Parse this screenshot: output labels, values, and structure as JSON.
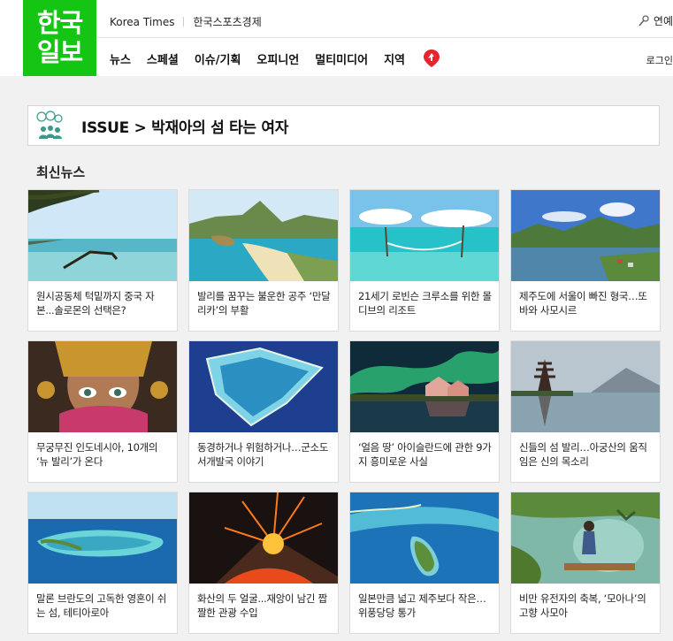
{
  "header": {
    "logo_line1": "한국",
    "logo_line2": "일보",
    "top_links": [
      "Korea Times",
      "한국스포츠경제"
    ],
    "top_right": "연예",
    "nav": [
      "뉴스",
      "스페셜",
      "이슈/기획",
      "오피니언",
      "멀티미디어",
      "지역"
    ],
    "login": "로그인"
  },
  "issue": {
    "title": "ISSUE > 박재아의 섬 타는 여자"
  },
  "section_title": "최신뉴스",
  "articles": [
    {
      "title": "원시공동체 턱밑까지 중국 자본...솔로몬의 선택은?"
    },
    {
      "title": "발리를 꿈꾸는 불운한 공주 ‘만달리카’의 부활"
    },
    {
      "title": "21세기 로빈슨 크루소를 위한 몰디브의 리조트"
    },
    {
      "title": "제주도에 서울이 빠진 형국…또바와 사모시르"
    },
    {
      "title": "무궁무진 인도네시아, 10개의 ‘뉴 발리’가 온다"
    },
    {
      "title": "동경하거나 위험하거나…군소도서개발국 이야기"
    },
    {
      "title": "‘얼음 땅’ 아이슬란드에 관한 9가지 흥미로운 사실"
    },
    {
      "title": "신들의 섬 발리…아궁산의 움직임은 신의 목소리"
    },
    {
      "title": "말론 브란도의 고독한 영혼이 쉬는 섬, 테티아로아"
    },
    {
      "title": "화산의 두 얼굴...재앙이 남긴 짭짤한 관광 수입"
    },
    {
      "title": "일본만큼 넓고 제주보다 작은…위풍당당 통가"
    },
    {
      "title": "비만 유전자의 축복, ‘모아나’의 고향 사모아"
    }
  ],
  "colors": {
    "brand": "#14c514",
    "pin": "#e8242d"
  }
}
